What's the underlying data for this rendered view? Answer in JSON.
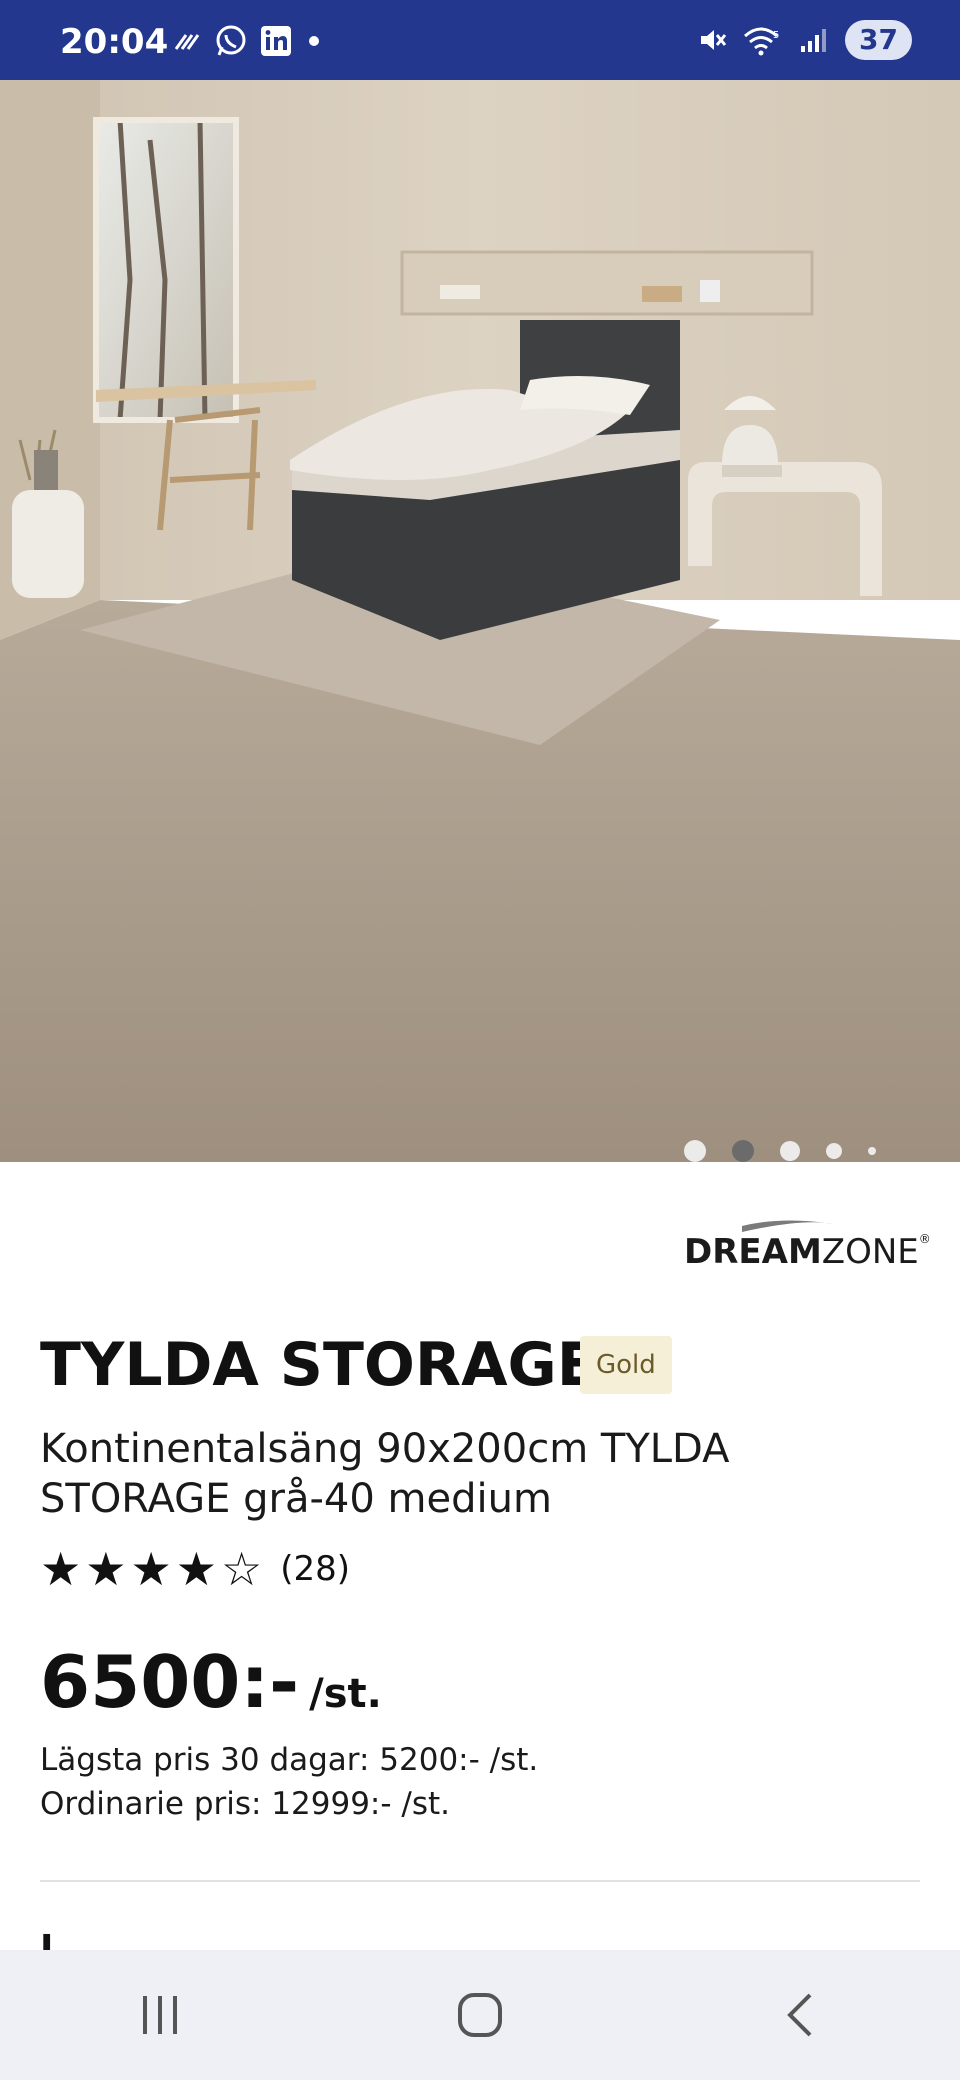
{
  "status_bar": {
    "time": "20:04",
    "battery": "37"
  },
  "gallery": {
    "image_alt": "Kontinentalsäng TYLDA STORAGE i ett ljust sovrum",
    "dots": [
      {
        "size": 22,
        "active": false
      },
      {
        "size": 22,
        "active": true
      },
      {
        "size": 20,
        "active": false
      },
      {
        "size": 16,
        "active": false
      },
      {
        "size": 8,
        "active": false
      }
    ]
  },
  "product": {
    "brand": "DREAMZONE",
    "brand_bold": "DREAM",
    "brand_light": "ZONE",
    "brand_mark": "®",
    "name": "TYLDA STORAGE",
    "badge": "Gold",
    "description": "Kontinentalsäng 90x200cm TYLDA STORAGE grå-40 medium",
    "rating": 4,
    "rating_max": 5,
    "review_count": "(28)",
    "price": "6500:-",
    "price_unit": "/st.",
    "lowest_price": "Lägsta pris 30 dagar: 5200:- /st.",
    "regular_price": "Ordinarie pris: 12999:- /st.",
    "next_section_peek": "I"
  },
  "nav": {
    "recents": "recents-icon",
    "home": "home-icon",
    "back": "back-icon"
  }
}
